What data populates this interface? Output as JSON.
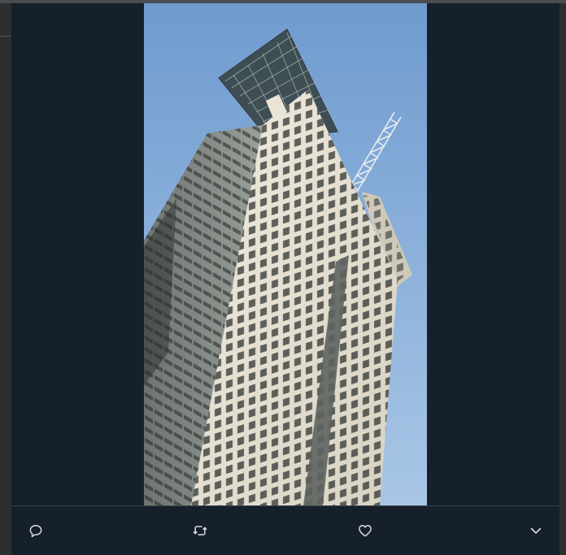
{
  "media": {
    "alt": "",
    "colors": {
      "sky_top": "#6f9bcf",
      "sky_bottom": "#a9c6e6",
      "facade_light": "#e9e4d6",
      "facade_shadow": "#6f7470",
      "window_dark": "#3b3f3c",
      "background": "#15202b"
    }
  },
  "actions": [
    {
      "name": "reply",
      "icon": "speech-bubble-icon"
    },
    {
      "name": "retweet",
      "icon": "retweet-arrows-icon"
    },
    {
      "name": "like",
      "icon": "heart-icon"
    },
    {
      "name": "more",
      "icon": "chevron-down-icon"
    }
  ],
  "theme": {
    "icon_color": "#d9dde1",
    "divider": "#38444d"
  }
}
